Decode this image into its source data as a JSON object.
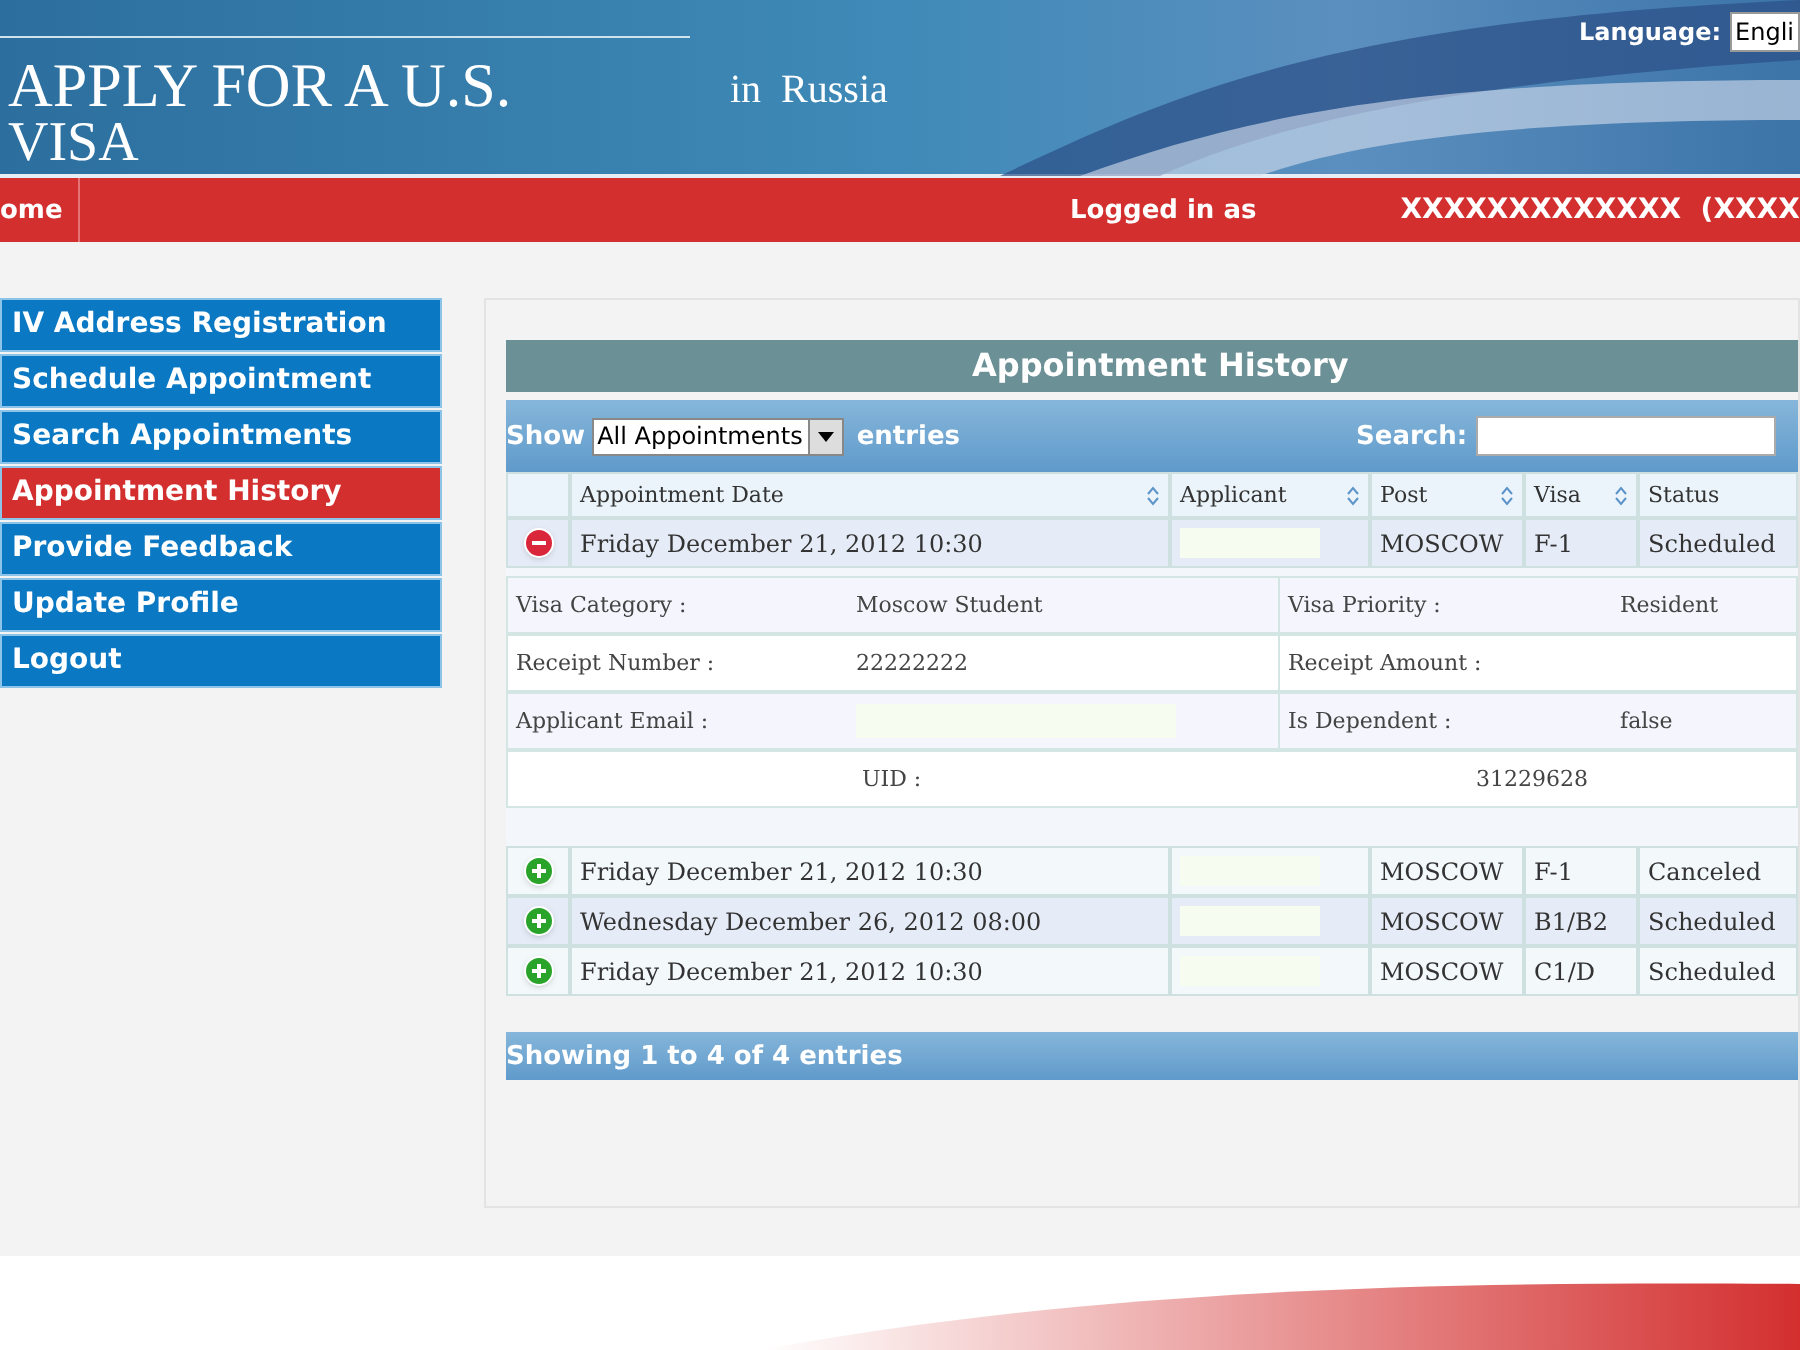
{
  "header": {
    "title_line1": "APPLY FOR A U.S.",
    "title_line2": "VISA",
    "country": "in  Russia",
    "language_label": "Language:",
    "language_value": "Engli"
  },
  "topbar": {
    "home": "ome",
    "logged_in_label": "Logged in as",
    "user": "XXXXXXXXXXXXX  (XXXX"
  },
  "sidebar": {
    "items": [
      {
        "label": "IV Address Registration",
        "selected": false
      },
      {
        "label": "Schedule Appointment",
        "selected": false
      },
      {
        "label": "Search Appointments",
        "selected": false
      },
      {
        "label": "Appointment History",
        "selected": true
      },
      {
        "label": "Provide Feedback",
        "selected": false
      },
      {
        "label": "Update Profile",
        "selected": false
      },
      {
        "label": "Logout",
        "selected": false
      }
    ]
  },
  "panel": {
    "title": "Appointment History",
    "show_label": "Show",
    "show_value": "All Appointments",
    "entries_label": "entries",
    "search_label": "Search:",
    "columns": [
      "Appointment Date",
      "Applicant",
      "Post",
      "Visa",
      "Status"
    ],
    "rows": [
      {
        "date": "Friday December 21, 2012 10:30",
        "post": "MOSCOW",
        "visa": "F-1",
        "status": "Scheduled",
        "expanded": true,
        "details": [
          {
            "label1": "Visa Category :",
            "value1": "Moscow Student",
            "label2": "Visa Priority :",
            "value2": "Resident"
          },
          {
            "label1": "Receipt Number :",
            "value1": "22222222",
            "label2": "Receipt Amount :"
          },
          {
            "label1": "Applicant Email :",
            "label2": "Is Dependent :",
            "value2": "false"
          }
        ],
        "uid_label": "UID :",
        "uid_value": "31229628"
      },
      {
        "date": "Friday December 21, 2012 10:30",
        "post": "MOSCOW",
        "visa": "F-1",
        "status": "Canceled",
        "expanded": false
      },
      {
        "date": "Wednesday December 26, 2012 08:00",
        "post": "MOSCOW",
        "visa": "B1/B2",
        "status": "Scheduled",
        "expanded": false
      },
      {
        "date": "Friday December 21, 2012 10:30",
        "post": "MOSCOW",
        "visa": "C1/D",
        "status": "Scheduled",
        "expanded": false
      }
    ],
    "info": "Showing 1 to 4 of 4 entries"
  }
}
